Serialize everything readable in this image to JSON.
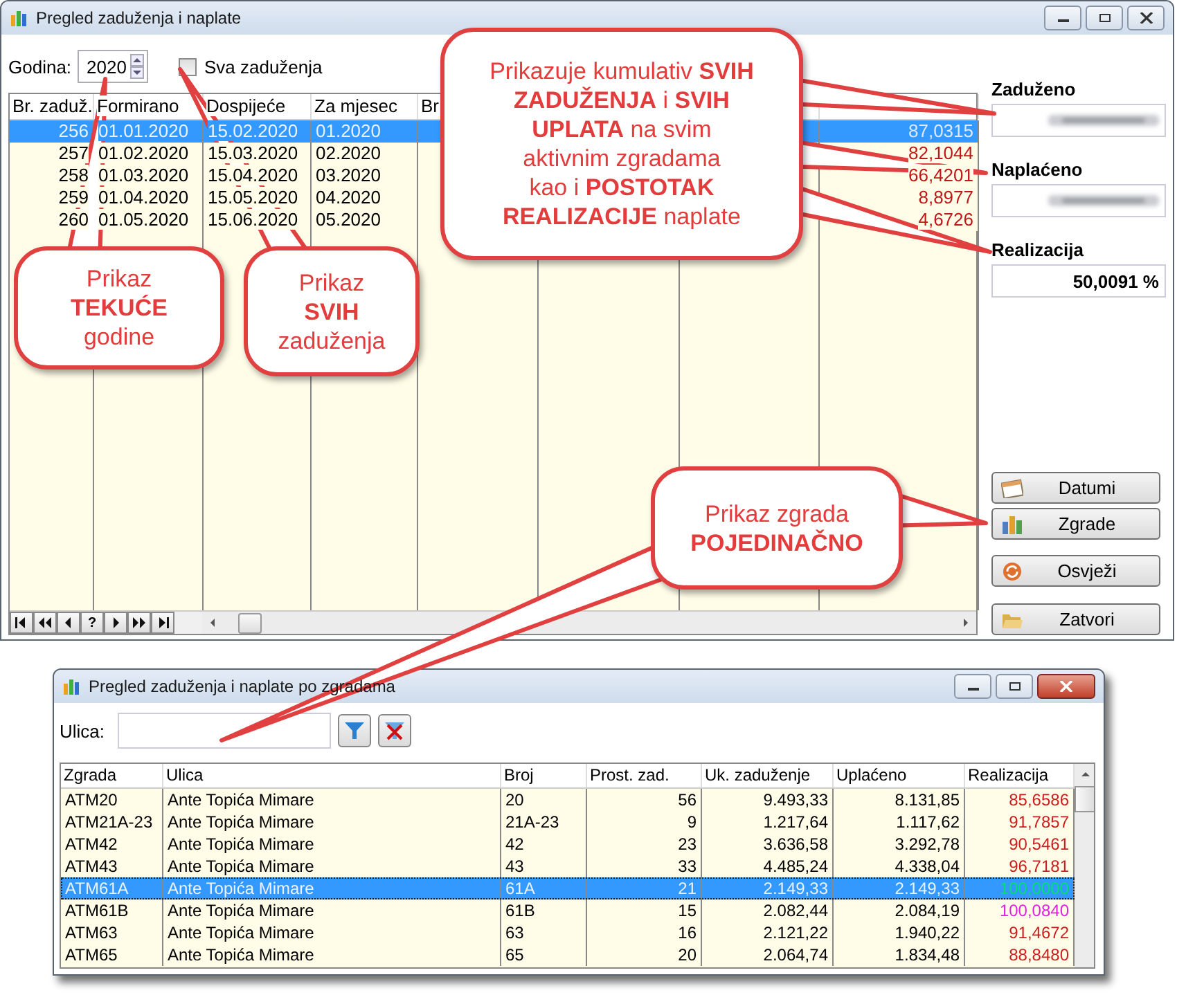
{
  "main_window": {
    "title": "Pregled zaduženja i naplate",
    "year_label": "Godina:",
    "year": "2020",
    "all_checkbox": {
      "label": "Sva zaduženja",
      "checked": false
    },
    "table": {
      "columns": [
        "Br. zaduž.",
        "Formirano",
        "Dospijeće",
        "Za mjesec",
        "Br"
      ],
      "rows": [
        {
          "cells": [
            "256",
            "01.01.2020",
            "15.02.2020",
            "01.2020"
          ],
          "column_8": "87,0315",
          "selected": true
        },
        {
          "cells": [
            "257",
            "01.02.2020",
            "15.03.2020",
            "02.2020"
          ],
          "column_8": "82,1044",
          "selected": false
        },
        {
          "cells": [
            "258",
            "01.03.2020",
            "15.04.2020",
            "03.2020"
          ],
          "column_8": "66,4201",
          "selected": false
        },
        {
          "cells": [
            "259",
            "01.04.2020",
            "15.05.2020",
            "04.2020"
          ],
          "column_8": "8,8977",
          "selected": false
        },
        {
          "cells": [
            "260",
            "01.05.2020",
            "15.06.2020",
            "05.2020"
          ],
          "column_8": "4,6726",
          "selected": false
        }
      ]
    },
    "navigator": [
      {
        "kind": "first"
      },
      {
        "kind": "prev_page"
      },
      {
        "kind": "prev"
      },
      {
        "kind": "help",
        "label": "?"
      },
      {
        "kind": "next"
      },
      {
        "kind": "next_page"
      },
      {
        "kind": "last"
      }
    ],
    "summary": [
      {
        "label": "Zaduženo",
        "kind": "blurred"
      },
      {
        "label": "Naplaćeno",
        "kind": "blurred"
      },
      {
        "label": "Realizacija",
        "kind": "value",
        "value": "50,0091 %"
      }
    ],
    "buttons": [
      {
        "label": "Datumi"
      },
      {
        "label": "Zgrade"
      },
      {
        "label": "Osvježi"
      },
      {
        "label": "Zatvori"
      }
    ]
  },
  "callouts": [
    {
      "text": "Prikazuje kumulativ **SVIH**\n**ZADUŽENJA** i **SVIH**\n**UPLATA** na svim\naktivnim zgradama\nkao i **POSTOTAK**\n**REALIZACIJE** naplate"
    },
    {
      "text": "Prikaz\n**TEKUĆE**\ngodine"
    },
    {
      "text": "Prikaz\n**SVIH**\nzaduženja"
    },
    {
      "text": "Prikaz zgrada\n**POJEDINAČNO**"
    }
  ],
  "buildings_window": {
    "title": "Pregled zaduženja i naplate po zgradama",
    "street_label": "Ulica:",
    "table": {
      "columns": [
        "Zgrada",
        "Ulica",
        "Broj",
        "Prost. zad.",
        "Uk. zaduženje",
        "Uplaćeno",
        "Realizacija"
      ],
      "rows": [
        {
          "cells": [
            "ATM20",
            "Ante Topića Mimare",
            "20",
            "56",
            "9.493,33",
            "8.131,85",
            "85,6586"
          ],
          "color": "#cc1f1f",
          "selected": false
        },
        {
          "cells": [
            "ATM21A-23",
            "Ante Topića Mimare",
            "21A-23",
            "9",
            "1.217,64",
            "1.117,62",
            "91,7857"
          ],
          "color": "#cc1f1f",
          "selected": false
        },
        {
          "cells": [
            "ATM42",
            "Ante Topića Mimare",
            "42",
            "23",
            "3.636,58",
            "3.292,78",
            "90,5461"
          ],
          "color": "#cc1f1f",
          "selected": false
        },
        {
          "cells": [
            "ATM43",
            "Ante Topića Mimare",
            "43",
            "33",
            "4.485,24",
            "4.338,04",
            "96,7181"
          ],
          "color": "#cc1f1f",
          "selected": false
        },
        {
          "cells": [
            "ATM61A",
            "Ante Topića Mimare",
            "61A",
            "21",
            "2.149,33",
            "2.149,33",
            "100,0000"
          ],
          "color": "#00e070",
          "selected": true
        },
        {
          "cells": [
            "ATM61B",
            "Ante Topića Mimare",
            "61B",
            "15",
            "2.082,44",
            "2.084,19",
            "100,0840"
          ],
          "color": "#e020e0",
          "selected": false
        },
        {
          "cells": [
            "ATM63",
            "Ante Topića Mimare",
            "63",
            "16",
            "2.121,22",
            "1.940,22",
            "91,4672"
          ],
          "color": "#cc1f1f",
          "selected": false
        },
        {
          "cells": [
            "ATM65",
            "Ante Topića Mimare",
            "65",
            "20",
            "2.064,74",
            "1.834,48",
            "88,8480"
          ],
          "color": "#cc1f1f",
          "selected": false
        }
      ]
    }
  }
}
